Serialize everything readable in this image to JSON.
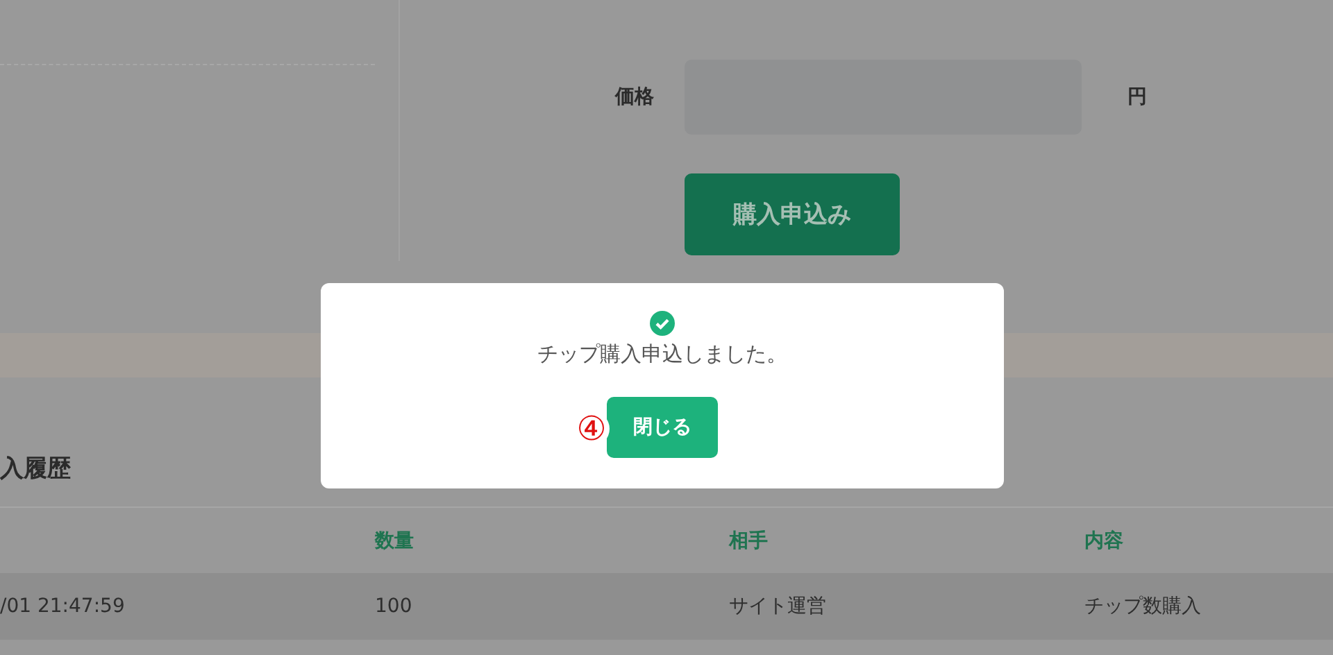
{
  "purchase_form": {
    "price_label": "価格",
    "price_unit": "円",
    "submit_button": "購入申込み"
  },
  "history": {
    "title": "入履歴",
    "columns": [
      "",
      "数量",
      "相手",
      "内容"
    ],
    "rows": [
      [
        "/01 21:47:59",
        "100",
        "サイト運営",
        "チップ数購入"
      ]
    ]
  },
  "dialog": {
    "message": "チップ購入申込しました。",
    "close_button": "閉じる",
    "annotation": "④"
  }
}
